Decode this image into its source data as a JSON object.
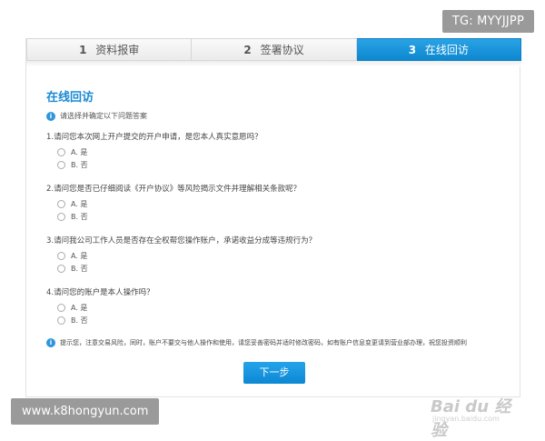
{
  "badges": {
    "tg": "TG: MYYJJPP",
    "site": "www.k8hongyun.com"
  },
  "steps": [
    {
      "num": "1",
      "label": "资料报审"
    },
    {
      "num": "2",
      "label": "签署协议"
    },
    {
      "num": "3",
      "label": "在线回访"
    }
  ],
  "page_title": "在线回访",
  "hint": "请选择并确定以下问题答案",
  "questions": [
    {
      "text": "1.请问您本次网上开户提交的开户申请，是您本人真实意愿吗？",
      "options": [
        "A. 是",
        "B. 否"
      ]
    },
    {
      "text": "2.请问您是否已仔细阅读《开户协议》等风险揭示文件并理解相关条款呢？",
      "options": [
        "A. 是",
        "B. 否"
      ]
    },
    {
      "text": "3.请问我公司工作人员是否存在全权帮您操作账户，承诺收益分成等违规行为？",
      "options": [
        "A. 是",
        "B. 否"
      ]
    },
    {
      "text": "4.请问您的账户是本人操作吗？",
      "options": [
        "A. 是",
        "B. 否"
      ]
    }
  ],
  "tip": "提示您，注意交易风险，同时，账户不要交与他人操作和使用，请您妥善密码并适时修改密码，如有账户信息变更请到营业部办理，祝您投资顺利",
  "next_button": "下一步",
  "watermark": {
    "main": "Bai du 经验",
    "sub": "jingyan.baidu.com"
  },
  "colors": {
    "accent": "#0d87cf",
    "title": "#1a8ad4"
  }
}
